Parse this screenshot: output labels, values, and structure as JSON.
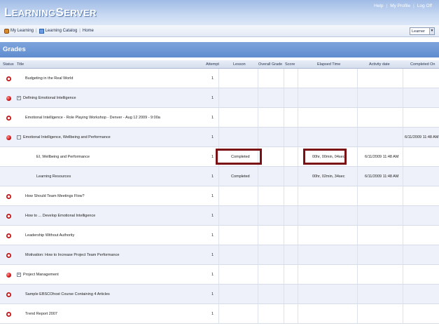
{
  "app": {
    "logo_first": "L",
    "logo_rest1": "EARNING",
    "logo_second": "S",
    "logo_rest2": "ERVER"
  },
  "toplinks": {
    "help": "Help",
    "profile": "My Profile",
    "logoff": "Log Off"
  },
  "nav": {
    "my_learning": "My Learning",
    "catalog": "Learning Catalog",
    "home": "Home",
    "sep": "|"
  },
  "role": {
    "selected": "Learner"
  },
  "section": {
    "title": "Grades"
  },
  "columns": {
    "status": "Status",
    "title": "Title",
    "attempt": "Attempt",
    "lesson": "Lesson",
    "overall": "Overall Grade",
    "score": "Score",
    "elapsed": "Elapsed Time",
    "activity": "Activity date",
    "completed": "Completed On"
  },
  "rows": [
    {
      "status": "incomplete",
      "expand": "",
      "title": "Budgeting in the Real World",
      "attempt": "1",
      "lesson": "",
      "elapsed": "",
      "activity": "",
      "completed": ""
    },
    {
      "status": "filled",
      "expand": "+",
      "title": "Defining Emotional Intelligence",
      "attempt": "1",
      "lesson": "",
      "elapsed": "",
      "activity": "",
      "completed": ""
    },
    {
      "status": "incomplete",
      "expand": "",
      "title": "Emotional Intelligence - Role Playing Workshop - Denver - Aug 12 2009 - 9:00a",
      "attempt": "1",
      "lesson": "",
      "elapsed": "",
      "activity": "",
      "completed": ""
    },
    {
      "status": "filled",
      "expand": "−",
      "title": "Emotional Intelligence, Wellbeing and Performance",
      "attempt": "1",
      "lesson": "",
      "elapsed": "",
      "activity": "",
      "completed": "6/11/2009 11:48 AM"
    },
    {
      "status": "none",
      "expand": "",
      "title": "EI, Wellbeing and Performance",
      "attempt": "1",
      "lesson": "Completed",
      "elapsed": "00hr, 00min, 04sec",
      "activity": "6/11/2009 11:48 AM",
      "completed": ""
    },
    {
      "status": "none",
      "expand": "",
      "title": "Learning Resources",
      "attempt": "1",
      "lesson": "Completed",
      "elapsed": "00hr, 02min, 34sec",
      "activity": "6/11/2009 11:48 AM",
      "completed": ""
    },
    {
      "status": "incomplete",
      "expand": "",
      "title": "How Should Team Meetings Flow?",
      "attempt": "1",
      "lesson": "",
      "elapsed": "",
      "activity": "",
      "completed": ""
    },
    {
      "status": "incomplete",
      "expand": "",
      "title": "How to ... Develop Emotional Intelligence",
      "attempt": "1",
      "lesson": "",
      "elapsed": "",
      "activity": "",
      "completed": ""
    },
    {
      "status": "incomplete",
      "expand": "",
      "title": "Leadership Without Authority",
      "attempt": "1",
      "lesson": "",
      "elapsed": "",
      "activity": "",
      "completed": ""
    },
    {
      "status": "incomplete",
      "expand": "",
      "title": "Motivation: How to Increase Project Team Performance",
      "attempt": "1",
      "lesson": "",
      "elapsed": "",
      "activity": "",
      "completed": ""
    },
    {
      "status": "filled",
      "expand": "+",
      "title": "Project Management",
      "attempt": "1",
      "lesson": "",
      "elapsed": "",
      "activity": "",
      "completed": ""
    },
    {
      "status": "incomplete",
      "expand": "",
      "title": "Sample EBSCOhost Course Containing 4 Articles",
      "attempt": "1",
      "lesson": "",
      "elapsed": "",
      "activity": "",
      "completed": ""
    },
    {
      "status": "incomplete",
      "expand": "",
      "title": "Trend Report 2007",
      "attempt": "1",
      "lesson": "",
      "elapsed": "",
      "activity": "",
      "completed": ""
    }
  ],
  "colors": {
    "header": "#9fbbe6",
    "grades_bar": "#5f8ccf",
    "highlight": "#7a0f14",
    "status_red": "#d41a1a"
  }
}
